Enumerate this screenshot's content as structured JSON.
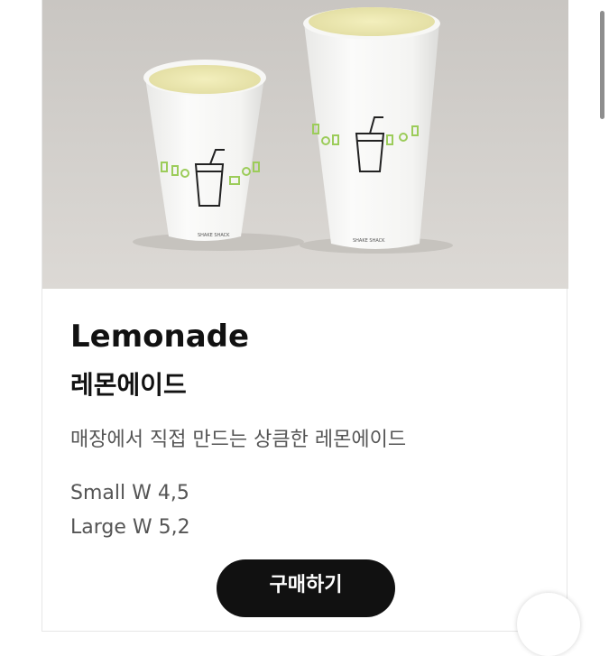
{
  "product": {
    "name_en": "Lemonade",
    "name_ko": "레몬에이드",
    "description": "매장에서 직접 만드는 상큼한 레몬에이드",
    "prices": [
      {
        "text": "Small W 4,5"
      },
      {
        "text": "Large W 5,2"
      }
    ],
    "buy_label": "구매하기"
  },
  "image": {
    "description_icon": "lemonade-cups-photo"
  },
  "colors": {
    "button_bg": "#111111",
    "button_text": "#ffffff",
    "title": "#111111",
    "body_text": "#555555",
    "accent_green": "#9ccc5a"
  }
}
